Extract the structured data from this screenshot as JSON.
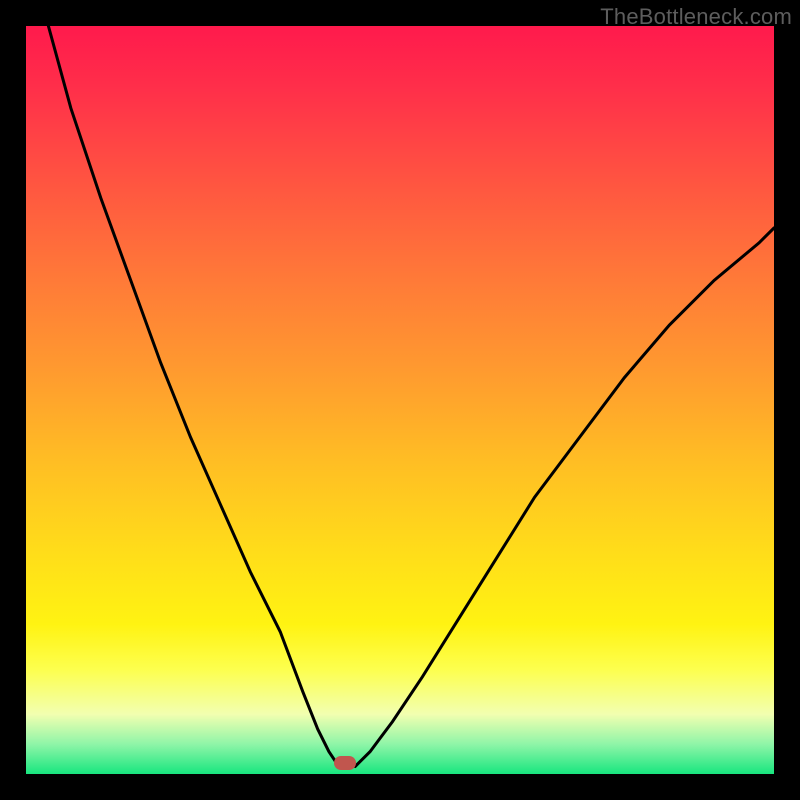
{
  "watermark": "TheBottleneck.com",
  "colors": {
    "curve": "#000000",
    "marker": "#c1564e",
    "frame_bg": "#000000"
  },
  "marker": {
    "x_frac": 0.427,
    "y_frac": 0.985
  },
  "chart_data": {
    "type": "line",
    "title": "",
    "xlabel": "",
    "ylabel": "",
    "xlim": [
      0,
      100
    ],
    "ylim": [
      0,
      100
    ],
    "grid": false,
    "legend": false,
    "note": "Axes unlabeled; values estimated from pixel positions. Two branches form a V-curve meeting near x≈42.",
    "series": [
      {
        "name": "left-branch",
        "x": [
          3,
          6,
          10,
          14,
          18,
          22,
          26,
          30,
          34,
          37,
          39,
          40.5,
          41.5,
          42.5
        ],
        "y": [
          100,
          89,
          77,
          66,
          55,
          45,
          36,
          27,
          19,
          11,
          6,
          3,
          1.5,
          1
        ]
      },
      {
        "name": "right-branch",
        "x": [
          44,
          46,
          49,
          53,
          58,
          63,
          68,
          74,
          80,
          86,
          92,
          98,
          100
        ],
        "y": [
          1,
          3,
          7,
          13,
          21,
          29,
          37,
          45,
          53,
          60,
          66,
          71,
          73
        ]
      }
    ],
    "markers": [
      {
        "name": "optimum",
        "x": 42.7,
        "y": 1.5
      }
    ]
  }
}
